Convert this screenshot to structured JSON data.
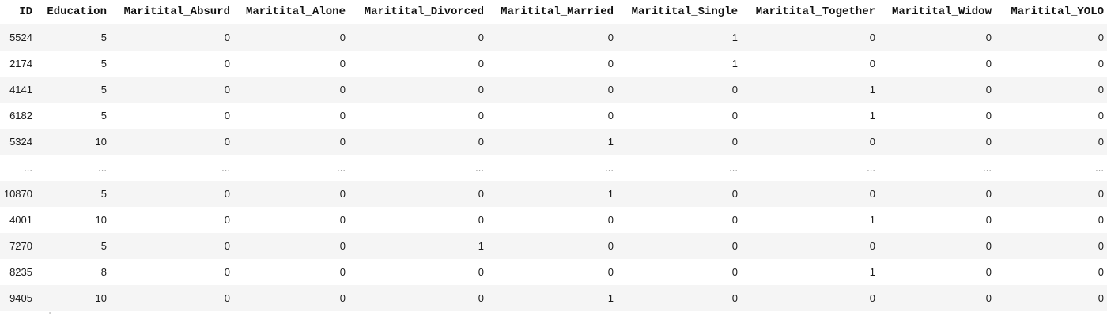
{
  "dataframe": {
    "columns": [
      "ID",
      "Education",
      "Maritital_Absurd",
      "Maritital_Alone",
      "Maritital_Divorced",
      "Maritital_Married",
      "Maritital_Single",
      "Maritital_Together",
      "Maritital_Widow",
      "Maritital_YOLO"
    ],
    "rows": [
      [
        "5524",
        "5",
        "0",
        "0",
        "0",
        "0",
        "1",
        "0",
        "0",
        "0"
      ],
      [
        "2174",
        "5",
        "0",
        "0",
        "0",
        "0",
        "1",
        "0",
        "0",
        "0"
      ],
      [
        "4141",
        "5",
        "0",
        "0",
        "0",
        "0",
        "0",
        "1",
        "0",
        "0"
      ],
      [
        "6182",
        "5",
        "0",
        "0",
        "0",
        "0",
        "0",
        "1",
        "0",
        "0"
      ],
      [
        "5324",
        "10",
        "0",
        "0",
        "0",
        "1",
        "0",
        "0",
        "0",
        "0"
      ],
      [
        "...",
        "...",
        "...",
        "...",
        "...",
        "...",
        "...",
        "...",
        "...",
        "..."
      ],
      [
        "10870",
        "5",
        "0",
        "0",
        "0",
        "1",
        "0",
        "0",
        "0",
        "0"
      ],
      [
        "4001",
        "10",
        "0",
        "0",
        "0",
        "0",
        "0",
        "1",
        "0",
        "0"
      ],
      [
        "7270",
        "5",
        "0",
        "0",
        "1",
        "0",
        "0",
        "0",
        "0",
        "0"
      ],
      [
        "8235",
        "8",
        "0",
        "0",
        "0",
        "0",
        "0",
        "1",
        "0",
        "0"
      ],
      [
        "9405",
        "10",
        "0",
        "0",
        "0",
        "1",
        "0",
        "0",
        "0",
        "0"
      ]
    ]
  }
}
